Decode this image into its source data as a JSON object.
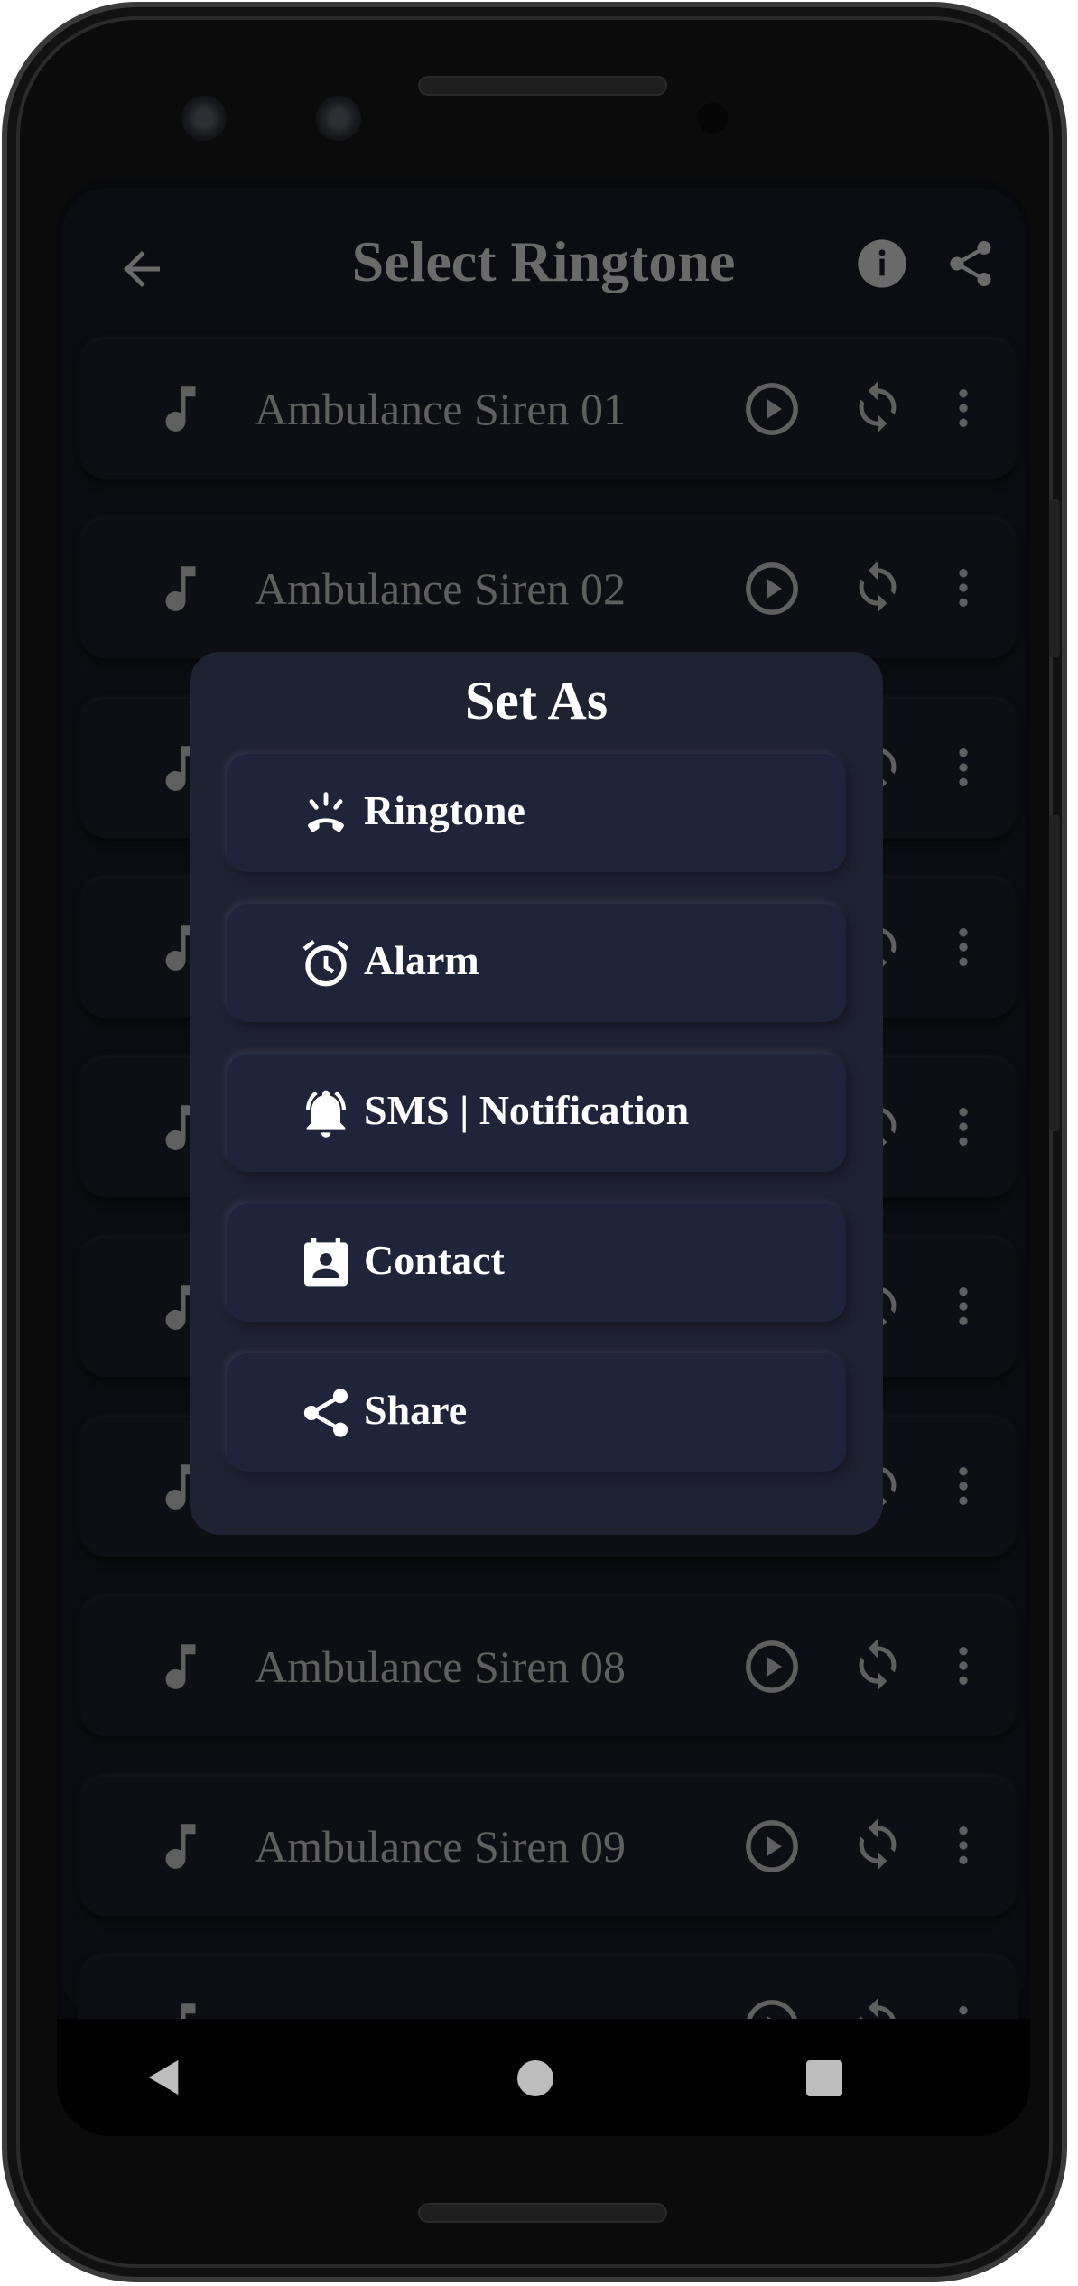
{
  "header": {
    "title": "Select Ringtone",
    "back_icon": "arrow-left-icon",
    "info_icon": "info-icon",
    "share_icon": "share-icon"
  },
  "list": {
    "items": [
      {
        "name": "Ambulance Siren 01"
      },
      {
        "name": "Ambulance Siren 02"
      },
      {
        "name": ""
      },
      {
        "name": ""
      },
      {
        "name": ""
      },
      {
        "name": ""
      },
      {
        "name": ""
      },
      {
        "name": "Ambulance Siren 08"
      },
      {
        "name": "Ambulance Siren 09"
      },
      {
        "name": ""
      }
    ]
  },
  "dialog": {
    "title": "Set As",
    "options": [
      {
        "label": "Ringtone",
        "icon": "ringing-phone-icon"
      },
      {
        "label": "Alarm",
        "icon": "alarm-clock-icon"
      },
      {
        "label": "SMS | Notification",
        "icon": "bell-ringing-icon"
      },
      {
        "label": "Contact",
        "icon": "contact-card-icon"
      },
      {
        "label": "Share",
        "icon": "share-icon"
      }
    ]
  },
  "nav": {
    "back": "triangle-back-icon",
    "home": "circle-home-icon",
    "recents": "square-recents-icon"
  },
  "colors": {
    "dialog_bg": "#1f2232",
    "option_bg": "#20243a",
    "dim_text": "#5f5f5f",
    "screen_bg": "#0c0d12"
  }
}
